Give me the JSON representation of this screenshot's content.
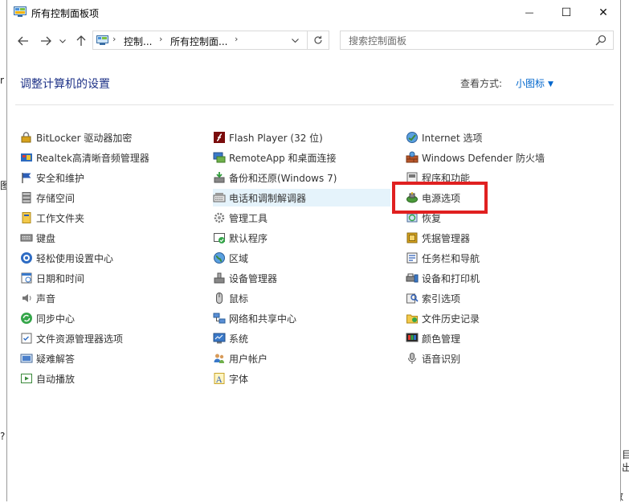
{
  "window": {
    "title": "所有控制面板项",
    "controls": {
      "minimize": "—",
      "maximize": "☐",
      "close": "✕"
    }
  },
  "outside_fragments": [
    "图",
    "到",
    "数",
    "?",
    "目",
    "出",
    "6",
    "r"
  ],
  "address_bar": {
    "crumbs": [
      "控制...",
      "所有控制面..."
    ],
    "separator": "›"
  },
  "search": {
    "placeholder": "搜索控制面板"
  },
  "header": {
    "title": "调整计算机的设置",
    "view_by_label": "查看方式:",
    "view_by_value": "小图标"
  },
  "columns": [
    [
      {
        "label": "BitLocker 驱动器加密",
        "icon": "bitlocker-icon"
      },
      {
        "label": "Realtek高清晰音频管理器",
        "icon": "realtek-audio-icon"
      },
      {
        "label": "安全和维护",
        "icon": "security-flag-icon"
      },
      {
        "label": "存储空间",
        "icon": "storage-spaces-icon"
      },
      {
        "label": "工作文件夹",
        "icon": "work-folders-icon"
      },
      {
        "label": "键盘",
        "icon": "keyboard-icon"
      },
      {
        "label": "轻松使用设置中心",
        "icon": "ease-of-access-icon"
      },
      {
        "label": "日期和时间",
        "icon": "date-time-icon"
      },
      {
        "label": "声音",
        "icon": "sound-icon"
      },
      {
        "label": "同步中心",
        "icon": "sync-center-icon"
      },
      {
        "label": "文件资源管理器选项",
        "icon": "file-explorer-options-icon"
      },
      {
        "label": "疑难解答",
        "icon": "troubleshooting-icon"
      },
      {
        "label": "自动播放",
        "icon": "autoplay-icon"
      }
    ],
    [
      {
        "label": "Flash Player (32 位)",
        "icon": "flash-player-icon"
      },
      {
        "label": "RemoteApp 和桌面连接",
        "icon": "remoteapp-icon"
      },
      {
        "label": "备份和还原(Windows 7)",
        "icon": "backup-restore-icon"
      },
      {
        "label": "电话和调制解调器",
        "icon": "phone-modem-icon"
      },
      {
        "label": "管理工具",
        "icon": "admin-tools-icon"
      },
      {
        "label": "默认程序",
        "icon": "default-programs-icon"
      },
      {
        "label": "区域",
        "icon": "region-icon"
      },
      {
        "label": "设备管理器",
        "icon": "device-manager-icon"
      },
      {
        "label": "鼠标",
        "icon": "mouse-icon"
      },
      {
        "label": "网络和共享中心",
        "icon": "network-sharing-icon"
      },
      {
        "label": "系统",
        "icon": "system-icon"
      },
      {
        "label": "用户帐户",
        "icon": "user-accounts-icon"
      },
      {
        "label": "字体",
        "icon": "fonts-icon"
      }
    ],
    [
      {
        "label": "Internet 选项",
        "icon": "internet-options-icon"
      },
      {
        "label": "Windows Defender 防火墙",
        "icon": "firewall-icon"
      },
      {
        "label": "程序和功能",
        "icon": "programs-features-icon"
      },
      {
        "label": "电源选项",
        "icon": "power-options-icon"
      },
      {
        "label": "恢复",
        "icon": "recovery-icon"
      },
      {
        "label": "凭据管理器",
        "icon": "credential-manager-icon"
      },
      {
        "label": "任务栏和导航",
        "icon": "taskbar-navigation-icon"
      },
      {
        "label": "设备和打印机",
        "icon": "devices-printers-icon"
      },
      {
        "label": "索引选项",
        "icon": "indexing-options-icon"
      },
      {
        "label": "文件历史记录",
        "icon": "file-history-icon"
      },
      {
        "label": "颜色管理",
        "icon": "color-management-icon"
      },
      {
        "label": "语音识别",
        "icon": "speech-recognition-icon"
      }
    ]
  ],
  "colors": {
    "heading": "#1e3287",
    "link": "#0066cc",
    "highlight_row": "#e5f3fb",
    "annotation_box": "#e02020"
  }
}
